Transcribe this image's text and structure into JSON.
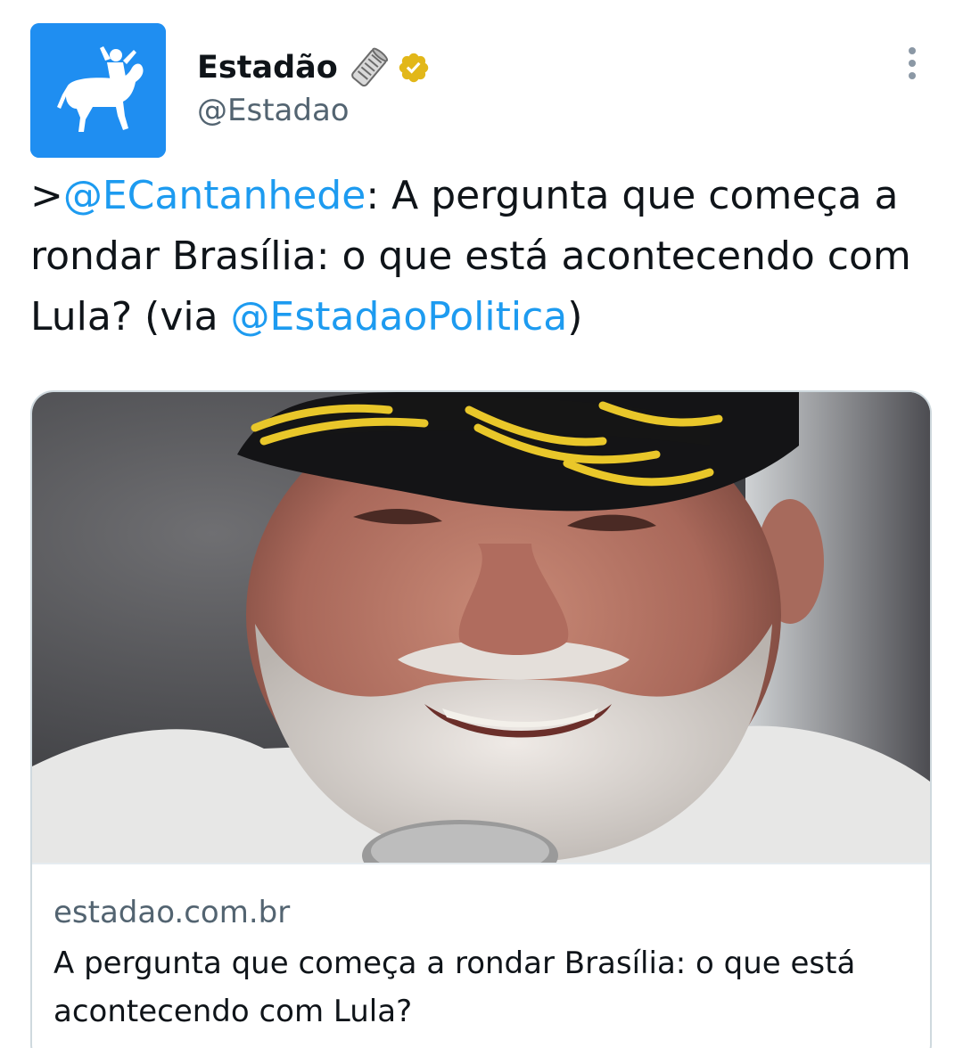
{
  "author": {
    "display_name": "Estadão",
    "handle": "@Estadao",
    "avatar_icon": "horse-rider-logo-icon",
    "avatar_bg": "#1f8ef1",
    "name_emoji_icon": "rolled-newspaper-icon",
    "badge_icon": "verified-gold-badge-icon",
    "badge_color": "#e2b719"
  },
  "more_icon": "more-vertical-icon",
  "tweet": {
    "prefix": ">",
    "mention_1": "@ECantanhede",
    "text_1": ": A pergunta que começa a rondar Brasília: o que está acontecendo com Lula? (via ",
    "mention_2": "@EstadaoPolitica",
    "text_2": ")",
    "mention_color": "#1d9bf0"
  },
  "card": {
    "image_subject": "photo-of-man-in-cap",
    "domain": "estadao.com.br",
    "title": "A pergunta que começa a rondar Brasília: o que está acontecendo com Lula?"
  }
}
